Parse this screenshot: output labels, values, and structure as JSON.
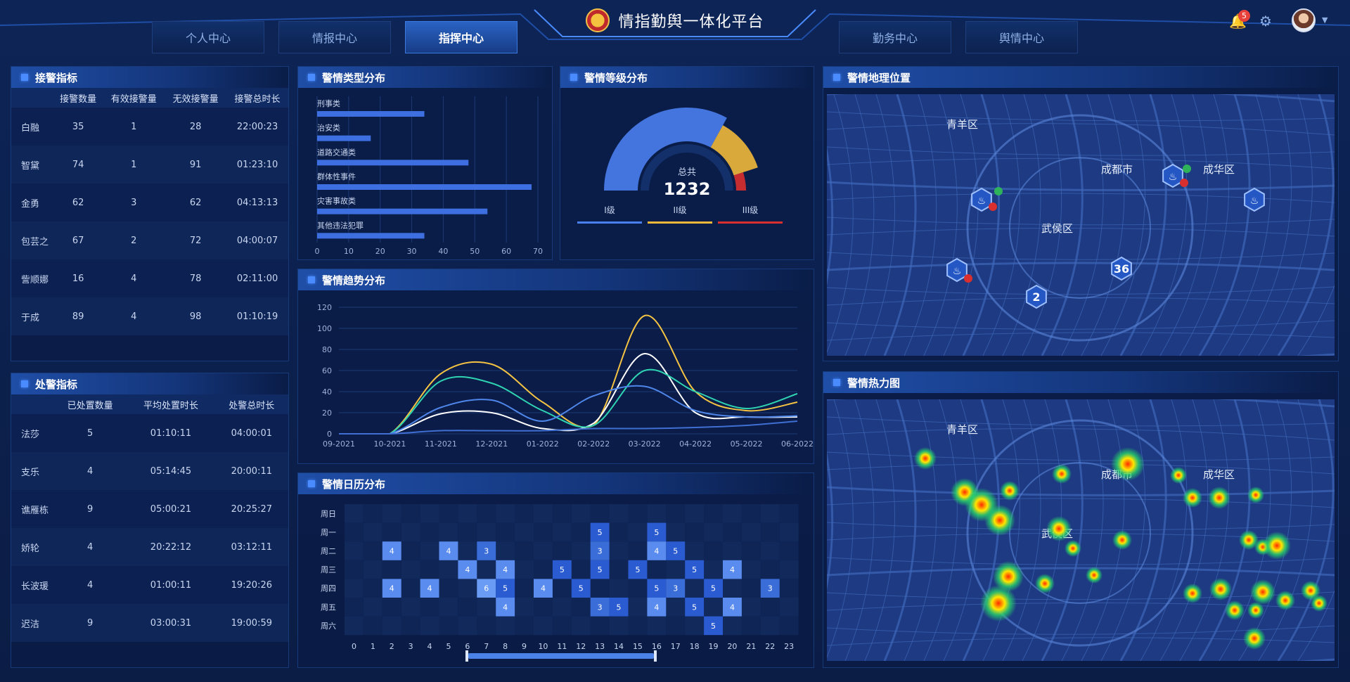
{
  "header": {
    "title": "情指勤舆一体化平台",
    "tabs_left": [
      {
        "label": "个人中心"
      },
      {
        "label": "情报中心"
      },
      {
        "label": "指挥中心"
      }
    ],
    "tabs_right": [
      {
        "label": "勤务中心"
      },
      {
        "label": "舆情中心"
      }
    ],
    "active_tab": "指挥中心",
    "notification_count": "5",
    "icons": [
      "police-emblem-icon",
      "bell-icon",
      "gear-icon",
      "avatar",
      "chevron-down-icon"
    ]
  },
  "jiejing": {
    "title": "接警指标",
    "columns": [
      "",
      "接警数量",
      "有效接警量",
      "无效接警量",
      "接警总时长"
    ],
    "rows": [
      [
        "白融",
        "35",
        "1",
        "28",
        "22:00:23"
      ],
      [
        "智黛",
        "74",
        "1",
        "91",
        "01:23:10"
      ],
      [
        "金勇",
        "62",
        "3",
        "62",
        "04:13:13"
      ],
      [
        "包芸之",
        "67",
        "2",
        "72",
        "04:00:07"
      ],
      [
        "訾顺娜",
        "16",
        "4",
        "78",
        "02:11:00"
      ],
      [
        "于成",
        "89",
        "4",
        "98",
        "01:10:19"
      ]
    ]
  },
  "chujing": {
    "title": "处警指标",
    "columns": [
      "",
      "已处置数量",
      "平均处置时长",
      "处警总时长"
    ],
    "rows": [
      [
        "法莎",
        "5",
        "01:10:11",
        "04:00:01"
      ],
      [
        "支乐",
        "4",
        "05:14:45",
        "20:00:11"
      ],
      [
        "谯雁栋",
        "9",
        "05:00:21",
        "20:25:27"
      ],
      [
        "娇轮",
        "4",
        "20:22:12",
        "03:12:11"
      ],
      [
        "长波瑗",
        "4",
        "01:00:11",
        "19:20:26"
      ],
      [
        "迟洁",
        "9",
        "03:00:31",
        "19:00:59"
      ]
    ]
  },
  "type_dist": {
    "title": "警情类型分布",
    "chart_data": {
      "type": "bar",
      "orientation": "horizontal",
      "categories": [
        "刑事类",
        "治安类",
        "道路交通类",
        "群体性事件",
        "灾害事故类",
        "其他违法犯罪"
      ],
      "values": [
        34,
        17,
        48,
        68,
        54,
        34
      ],
      "xlim": [
        0,
        70
      ],
      "xticks": [
        0,
        10,
        20,
        30,
        40,
        50,
        60,
        70
      ],
      "color": "#3d6fe0"
    }
  },
  "level_dist": {
    "title": "警情等级分布",
    "total_label": "总共",
    "total": "1232",
    "chart_data": {
      "type": "pie",
      "style": "half-gauge",
      "labels": [
        "I级",
        "II级",
        "III级"
      ],
      "values": [
        66,
        24,
        10
      ],
      "colors": [
        "#4a7ff0",
        "#f0b93a",
        "#d9302f"
      ]
    }
  },
  "trend": {
    "title": "警情趋势分布",
    "chart_data": {
      "type": "line",
      "x": [
        "09-2021",
        "10-2021",
        "11-2021",
        "12-2021",
        "01-2022",
        "02-2022",
        "03-2022",
        "04-2022",
        "05-2022",
        "06-2022"
      ],
      "ylim": [
        0,
        120
      ],
      "yticks": [
        0,
        20,
        40,
        60,
        80,
        100,
        120
      ],
      "series": [
        {
          "color": "#f5c343",
          "values": [
            0,
            0,
            57,
            66,
            30,
            8,
            112,
            40,
            22,
            30
          ]
        },
        {
          "color": "#ffffff",
          "values": [
            0,
            0,
            19,
            20,
            5,
            10,
            76,
            20,
            16,
            16
          ]
        },
        {
          "color": "#2fd3b1",
          "values": [
            0,
            0,
            50,
            48,
            22,
            8,
            60,
            40,
            24,
            38
          ]
        },
        {
          "color": "#4f86ea",
          "values": [
            0,
            0,
            25,
            32,
            12,
            36,
            45,
            22,
            16,
            17
          ]
        },
        {
          "color": "#3f6fd2",
          "values": [
            0,
            0,
            3,
            3,
            3,
            5,
            5,
            6,
            8,
            12
          ]
        }
      ]
    }
  },
  "calendar": {
    "title": "警情日历分布",
    "chart_data": {
      "type": "heatmap",
      "y": [
        "周日",
        "周一",
        "周二",
        "周三",
        "周四",
        "周五",
        "周六"
      ],
      "x": [
        "0",
        "1",
        "2",
        "3",
        "4",
        "5",
        "6",
        "7",
        "8",
        "9",
        "10",
        "11",
        "12",
        "13",
        "14",
        "15",
        "16",
        "17",
        "18",
        "19",
        "20",
        "21",
        "22",
        "23"
      ],
      "cells": [
        {
          "x": 13,
          "y": 1,
          "v": 5
        },
        {
          "x": 16,
          "y": 1,
          "v": 5
        },
        {
          "x": 2,
          "y": 2,
          "v": 4
        },
        {
          "x": 5,
          "y": 2,
          "v": 4
        },
        {
          "x": 7,
          "y": 2,
          "v": 3
        },
        {
          "x": 13,
          "y": 2,
          "v": 3
        },
        {
          "x": 16,
          "y": 2,
          "v": 4
        },
        {
          "x": 17,
          "y": 2,
          "v": 5
        },
        {
          "x": 6,
          "y": 3,
          "v": 4
        },
        {
          "x": 8,
          "y": 3,
          "v": 4
        },
        {
          "x": 11,
          "y": 3,
          "v": 5
        },
        {
          "x": 13,
          "y": 3,
          "v": 5
        },
        {
          "x": 15,
          "y": 3,
          "v": 5
        },
        {
          "x": 18,
          "y": 3,
          "v": 5
        },
        {
          "x": 20,
          "y": 3,
          "v": 4
        },
        {
          "x": 2,
          "y": 4,
          "v": 4
        },
        {
          "x": 4,
          "y": 4,
          "v": 4
        },
        {
          "x": 7,
          "y": 4,
          "v": 6
        },
        {
          "x": 8,
          "y": 4,
          "v": 5
        },
        {
          "x": 10,
          "y": 4,
          "v": 4
        },
        {
          "x": 12,
          "y": 4,
          "v": 5
        },
        {
          "x": 16,
          "y": 4,
          "v": 5
        },
        {
          "x": 17,
          "y": 4,
          "v": 3
        },
        {
          "x": 19,
          "y": 4,
          "v": 5
        },
        {
          "x": 22,
          "y": 4,
          "v": 3
        },
        {
          "x": 8,
          "y": 5,
          "v": 4
        },
        {
          "x": 13,
          "y": 5,
          "v": 3
        },
        {
          "x": 14,
          "y": 5,
          "v": 5
        },
        {
          "x": 16,
          "y": 5,
          "v": 4
        },
        {
          "x": 18,
          "y": 5,
          "v": 5
        },
        {
          "x": 20,
          "y": 5,
          "v": 4
        },
        {
          "x": 19,
          "y": 6,
          "v": 5
        }
      ]
    }
  },
  "geo": {
    "title": "警情地理位置",
    "districts": [
      "青羊区",
      "成都市",
      "成华区",
      "武侯区"
    ],
    "cluster_labels": [
      "36",
      "2"
    ],
    "marker_icons": [
      "fire-marker-icon",
      "camera-marker-icon",
      "lightning-icon",
      "shield-icon"
    ]
  },
  "heatmap": {
    "title": "警情热力图",
    "districts": [
      "青羊区",
      "成都市",
      "成华区",
      "武侯区"
    ]
  }
}
